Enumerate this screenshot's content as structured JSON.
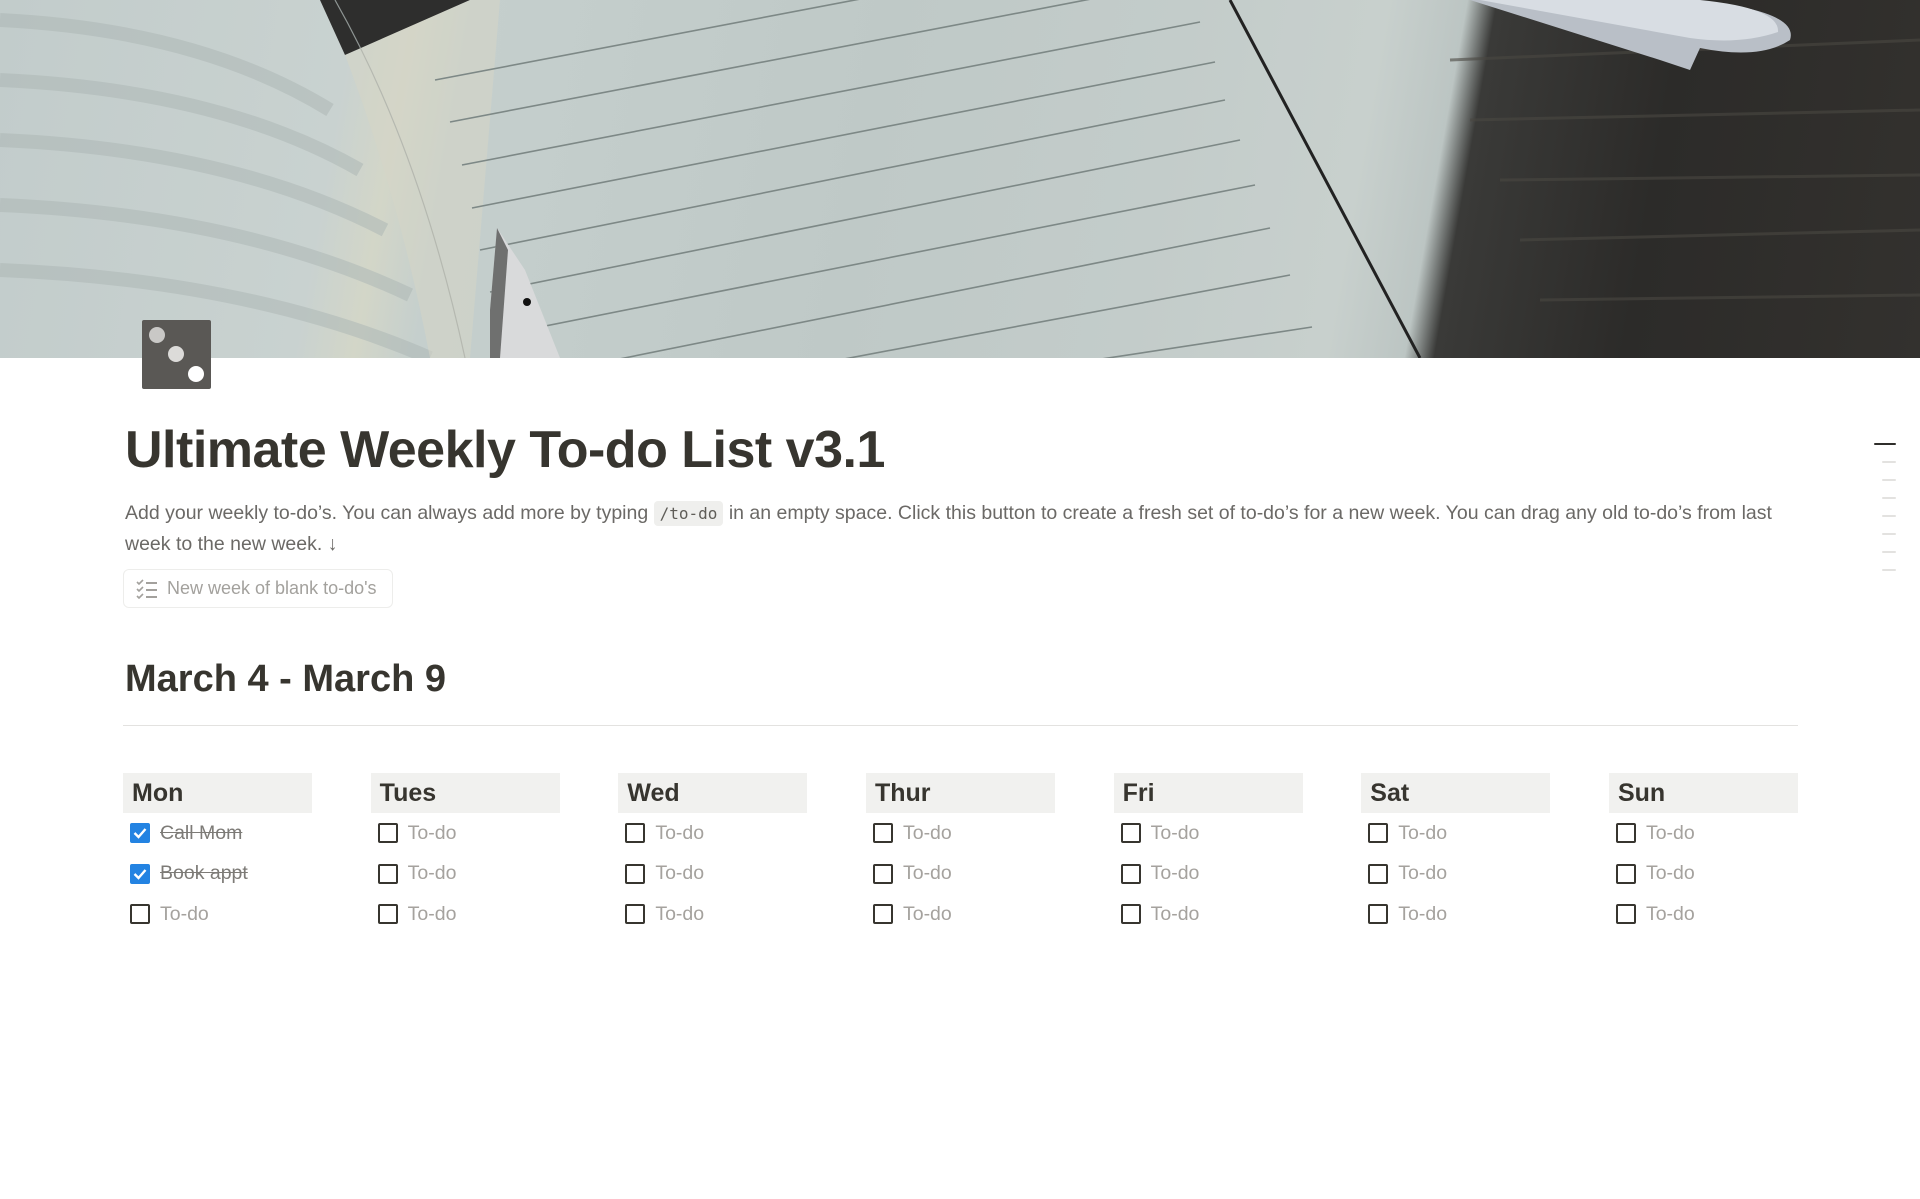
{
  "page": {
    "cover_alt": "Open lined notebook with fountain pen on dark wood table",
    "icon": "dice-three-icon",
    "title": "Ultimate Weekly To-do List v3.1",
    "description": {
      "before_code": "Add your weekly to-do’s. You can always add more by typing ",
      "code": "/to-do",
      "after_code": " in an empty space. Click this button to create a fresh set of to-do’s for a new week. You can drag any old to-do’s from last week to the new week. ↓"
    },
    "new_week_button": {
      "label": "New week of blank to-do's",
      "icon": "checklist-icon"
    }
  },
  "week": {
    "heading": "March 4 - March 9",
    "days": [
      {
        "name": "Mon",
        "todos": [
          {
            "text": "Call Mom",
            "checked": true,
            "placeholder": false
          },
          {
            "text": "Book appt",
            "checked": true,
            "placeholder": false
          },
          {
            "text": "To-do",
            "checked": false,
            "placeholder": true
          }
        ]
      },
      {
        "name": "Tues",
        "todos": [
          {
            "text": "To-do",
            "checked": false,
            "placeholder": true
          },
          {
            "text": "To-do",
            "checked": false,
            "placeholder": true
          },
          {
            "text": "To-do",
            "checked": false,
            "placeholder": true
          }
        ]
      },
      {
        "name": "Wed",
        "todos": [
          {
            "text": "To-do",
            "checked": false,
            "placeholder": true
          },
          {
            "text": "To-do",
            "checked": false,
            "placeholder": true
          },
          {
            "text": "To-do",
            "checked": false,
            "placeholder": true
          }
        ]
      },
      {
        "name": "Thur",
        "todos": [
          {
            "text": "To-do",
            "checked": false,
            "placeholder": true
          },
          {
            "text": "To-do",
            "checked": false,
            "placeholder": true
          },
          {
            "text": "To-do",
            "checked": false,
            "placeholder": true
          }
        ]
      },
      {
        "name": "Fri",
        "todos": [
          {
            "text": "To-do",
            "checked": false,
            "placeholder": true
          },
          {
            "text": "To-do",
            "checked": false,
            "placeholder": true
          },
          {
            "text": "To-do",
            "checked": false,
            "placeholder": true
          }
        ]
      },
      {
        "name": "Sat",
        "todos": [
          {
            "text": "To-do",
            "checked": false,
            "placeholder": true
          },
          {
            "text": "To-do",
            "checked": false,
            "placeholder": true
          },
          {
            "text": "To-do",
            "checked": false,
            "placeholder": true
          }
        ]
      },
      {
        "name": "Sun",
        "todos": [
          {
            "text": "To-do",
            "checked": false,
            "placeholder": true
          },
          {
            "text": "To-do",
            "checked": false,
            "placeholder": true
          },
          {
            "text": "To-do",
            "checked": false,
            "placeholder": true
          }
        ]
      }
    ]
  },
  "toc": {
    "entries": 8,
    "active_index": 0
  },
  "colors": {
    "text": "#37352f",
    "muted_text": "#6b6966",
    "placeholder": "#a5a29e",
    "checkbox_checked": "#2383e2",
    "column_header_bg": "#f1f1ef",
    "divider": "#e3e2e0",
    "page_icon_bg": "#5a5855"
  }
}
